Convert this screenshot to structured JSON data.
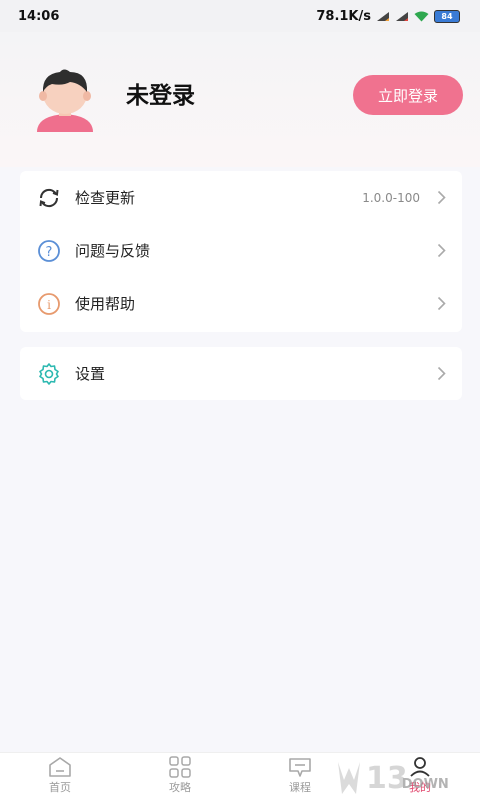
{
  "status_bar": {
    "time": "14:06",
    "network_speed": "78.1K/s",
    "battery": "84"
  },
  "profile": {
    "username": "未登录",
    "login_button": "立即登录"
  },
  "menu": [
    {
      "label": "检查更新",
      "value": "1.0.0-100",
      "icon": "refresh-icon"
    },
    {
      "label": "问题与反馈",
      "icon": "question-icon"
    },
    {
      "label": "使用帮助",
      "icon": "info-icon"
    }
  ],
  "settings": {
    "label": "设置",
    "icon": "gear-icon"
  },
  "nav": [
    {
      "label": "首页",
      "icon": "home-icon"
    },
    {
      "label": "攻略",
      "icon": "grid-icon"
    },
    {
      "label": "课程",
      "icon": "course-icon"
    },
    {
      "label": "我的",
      "icon": "profile-icon",
      "active": true
    }
  ],
  "watermark": {
    "number": "13",
    "suffix": "DOWN"
  },
  "colors": {
    "accent": "#f0728f",
    "active_tab": "#e1486e",
    "background": "#f7f7fb"
  }
}
